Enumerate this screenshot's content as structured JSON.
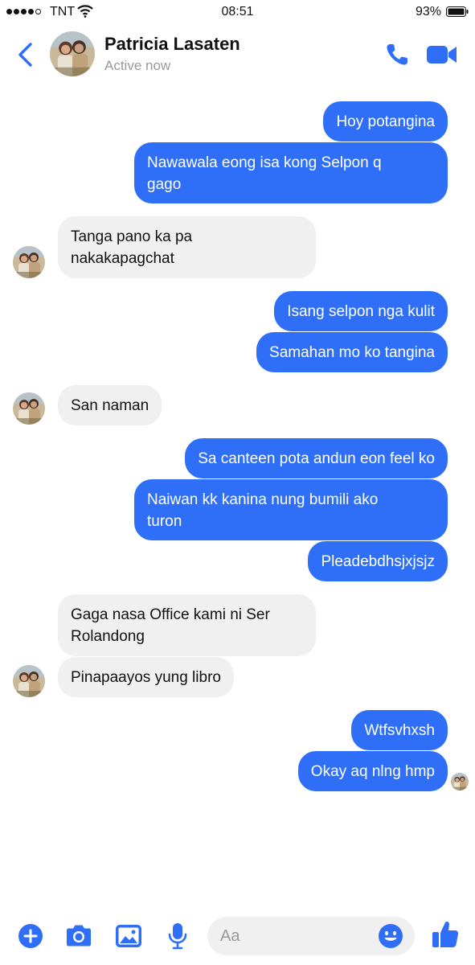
{
  "status_bar": {
    "carrier": "TNT",
    "time": "08:51",
    "battery": "93%"
  },
  "header": {
    "contact_name": "Patricia Lasaten",
    "status": "Active now",
    "icons": [
      "back-chevron-icon",
      "phone-icon",
      "video-camera-icon"
    ]
  },
  "messages": [
    {
      "sender": "me",
      "text": "Hoy potangina"
    },
    {
      "sender": "me",
      "lines": [
        "Nawawala eong isa kong Selpon q",
        "gago"
      ]
    },
    {
      "sender": "contact",
      "lines": [
        "Tanga pano ka pa",
        "nakakapagchat"
      ]
    },
    {
      "sender": "me",
      "text": "Isang selpon nga kulit"
    },
    {
      "sender": "me",
      "text": "Samahan mo ko tangina"
    },
    {
      "sender": "contact",
      "text": "San naman"
    },
    {
      "sender": "me",
      "text": "Sa canteen pota andun eon feel ko"
    },
    {
      "sender": "me",
      "lines": [
        "Naiwan kk kanina nung bumili ako",
        "turon"
      ]
    },
    {
      "sender": "me",
      "text": "Pleadebdhsjxjsjz"
    },
    {
      "sender": "contact",
      "lines": [
        "Gaga nasa Office kami ni Ser",
        "Rolandong"
      ]
    },
    {
      "sender": "contact",
      "text": "Pinapaayos yung libro"
    },
    {
      "sender": "me",
      "text": "Wtfsvhxsh"
    },
    {
      "sender": "me",
      "text": "Okay aq nlng hmp"
    }
  ],
  "composer": {
    "placeholder": "Aa",
    "icons": [
      "plus-icon",
      "camera-icon",
      "gallery-icon",
      "microphone-icon",
      "emoji-icon",
      "thumbs-up-icon"
    ]
  },
  "colors": {
    "accent": "#2f6ff7",
    "incoming_bubble": "#f0f0f0",
    "status_text": "#999999"
  }
}
